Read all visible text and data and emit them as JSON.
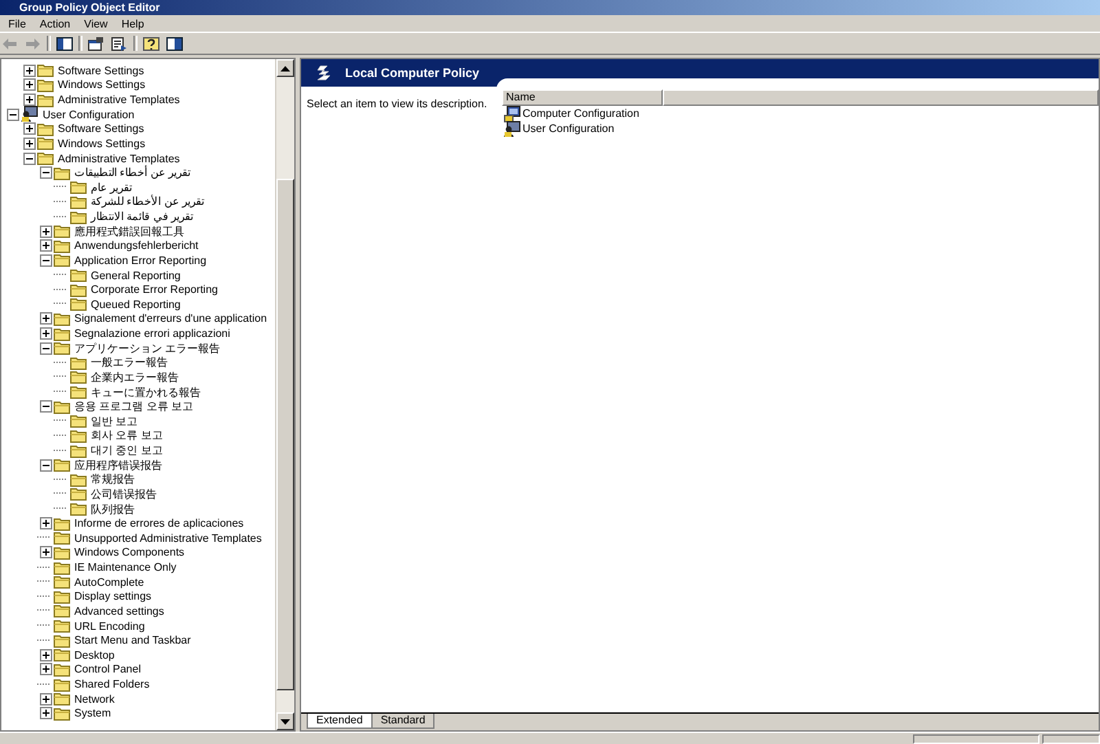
{
  "window": {
    "title": "Group Policy Object Editor"
  },
  "menu": [
    "File",
    "Action",
    "View",
    "Help"
  ],
  "tree": {
    "items_above": [
      {
        "label": "Software Settings",
        "kind": "branch",
        "expanded": false
      },
      {
        "label": "Windows Settings",
        "kind": "branch",
        "expanded": false
      },
      {
        "label": "Administrative Templates",
        "kind": "branch",
        "expanded": false
      }
    ],
    "items": [
      {
        "label": "User Configuration",
        "kind": "branch",
        "expanded": true,
        "children": [
          {
            "label": "Software Settings",
            "kind": "branch",
            "expanded": false
          },
          {
            "label": "Windows Settings",
            "kind": "branch",
            "expanded": false
          },
          {
            "label": "Administrative Templates",
            "kind": "branch",
            "expanded": true,
            "children": [
              {
                "label": "تقرير عن أخطاء التطبيقات",
                "kind": "branch",
                "expanded": true,
                "children": [
                  {
                    "label": "تقرير عام",
                    "kind": "leaf"
                  },
                  {
                    "label": "تقرير عن الأخطاء للشركة",
                    "kind": "leaf"
                  },
                  {
                    "label": "تقرير في قائمة الانتظار",
                    "kind": "leaf"
                  }
                ]
              },
              {
                "label": "應用程式錯誤回報工具",
                "kind": "branch",
                "expanded": false
              },
              {
                "label": "Anwendungsfehlerbericht",
                "kind": "branch",
                "expanded": false
              },
              {
                "label": "Application Error Reporting",
                "kind": "branch",
                "expanded": true,
                "children": [
                  {
                    "label": "General Reporting",
                    "kind": "leaf"
                  },
                  {
                    "label": "Corporate Error Reporting",
                    "kind": "leaf"
                  },
                  {
                    "label": "Queued Reporting",
                    "kind": "leaf"
                  }
                ]
              },
              {
                "label": "Signalement d'erreurs d'une application",
                "kind": "branch",
                "expanded": false
              },
              {
                "label": "Segnalazione errori applicazioni",
                "kind": "branch",
                "expanded": false
              },
              {
                "label": "アプリケーション エラー報告",
                "kind": "branch",
                "expanded": true,
                "children": [
                  {
                    "label": "一般エラー報告",
                    "kind": "leaf"
                  },
                  {
                    "label": "企業内エラー報告",
                    "kind": "leaf"
                  },
                  {
                    "label": "キューに置かれる報告",
                    "kind": "leaf"
                  }
                ]
              },
              {
                "label": "응용 프로그램 오류 보고",
                "kind": "branch",
                "expanded": true,
                "children": [
                  {
                    "label": "일반 보고",
                    "kind": "leaf"
                  },
                  {
                    "label": "회사 오류 보고",
                    "kind": "leaf"
                  },
                  {
                    "label": "대기 중인 보고",
                    "kind": "leaf"
                  }
                ]
              },
              {
                "label": "应用程序错误报告",
                "kind": "branch",
                "expanded": true,
                "children": [
                  {
                    "label": "常规报告",
                    "kind": "leaf"
                  },
                  {
                    "label": "公司错误报告",
                    "kind": "leaf"
                  },
                  {
                    "label": "队列报告",
                    "kind": "leaf"
                  }
                ]
              },
              {
                "label": "Informe de errores de aplicaciones",
                "kind": "branch",
                "expanded": false
              },
              {
                "label": "Unsupported Administrative Templates",
                "kind": "leaf"
              },
              {
                "label": "Windows Components",
                "kind": "branch",
                "expanded": false
              },
              {
                "label": "IE Maintenance Only",
                "kind": "leaf"
              },
              {
                "label": "AutoComplete",
                "kind": "leaf"
              },
              {
                "label": "Display settings",
                "kind": "leaf"
              },
              {
                "label": "Advanced settings",
                "kind": "leaf"
              },
              {
                "label": "URL Encoding",
                "kind": "leaf"
              },
              {
                "label": "Start Menu and Taskbar",
                "kind": "leaf"
              },
              {
                "label": "Desktop",
                "kind": "branch",
                "expanded": false
              },
              {
                "label": "Control Panel",
                "kind": "branch",
                "expanded": false
              },
              {
                "label": "Shared Folders",
                "kind": "leaf"
              },
              {
                "label": "Network",
                "kind": "branch",
                "expanded": false
              },
              {
                "label": "System",
                "kind": "branch",
                "expanded": false
              }
            ]
          }
        ]
      }
    ]
  },
  "details": {
    "title": "Local Computer Policy",
    "description": "Select an item to view its description.",
    "columns": [
      "Name"
    ],
    "rows": [
      "Computer Configuration",
      "User Configuration"
    ]
  },
  "tabs": [
    {
      "label": "Extended",
      "selected": true
    },
    {
      "label": "Standard",
      "selected": false
    }
  ]
}
